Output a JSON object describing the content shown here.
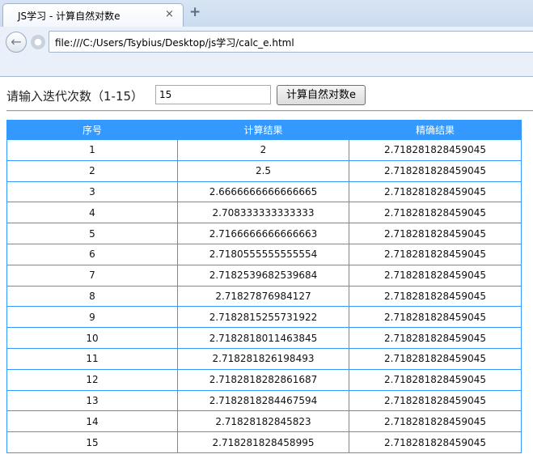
{
  "browser": {
    "tab_title": "JS学习 - 计算自然对数e",
    "tab_close": "×",
    "new_tab": "+",
    "url": "file:///C:/Users/Tsybius/Desktop/js学习/calc_e.html"
  },
  "form": {
    "prompt": "请输入迭代次数（1-15）",
    "input_value": "15",
    "button_label": "计算自然对数e"
  },
  "table": {
    "headers": [
      "序号",
      "计算结果",
      "精确结果"
    ],
    "rows": [
      [
        "1",
        "2",
        "2.718281828459045"
      ],
      [
        "2",
        "2.5",
        "2.718281828459045"
      ],
      [
        "3",
        "2.6666666666666665",
        "2.718281828459045"
      ],
      [
        "4",
        "2.708333333333333",
        "2.718281828459045"
      ],
      [
        "5",
        "2.7166666666666663",
        "2.718281828459045"
      ],
      [
        "6",
        "2.7180555555555554",
        "2.718281828459045"
      ],
      [
        "7",
        "2.7182539682539684",
        "2.718281828459045"
      ],
      [
        "8",
        "2.71827876984127",
        "2.718281828459045"
      ],
      [
        "9",
        "2.7182815255731922",
        "2.718281828459045"
      ],
      [
        "10",
        "2.7182818011463845",
        "2.718281828459045"
      ],
      [
        "11",
        "2.718281826198493",
        "2.718281828459045"
      ],
      [
        "12",
        "2.7182818282861687",
        "2.718281828459045"
      ],
      [
        "13",
        "2.7182818284467594",
        "2.718281828459045"
      ],
      [
        "14",
        "2.71828182845823",
        "2.718281828459045"
      ],
      [
        "15",
        "2.718281828458995",
        "2.718281828459045"
      ]
    ]
  },
  "colors": {
    "header_bg": "#3399ff",
    "border": "#3399ff"
  }
}
